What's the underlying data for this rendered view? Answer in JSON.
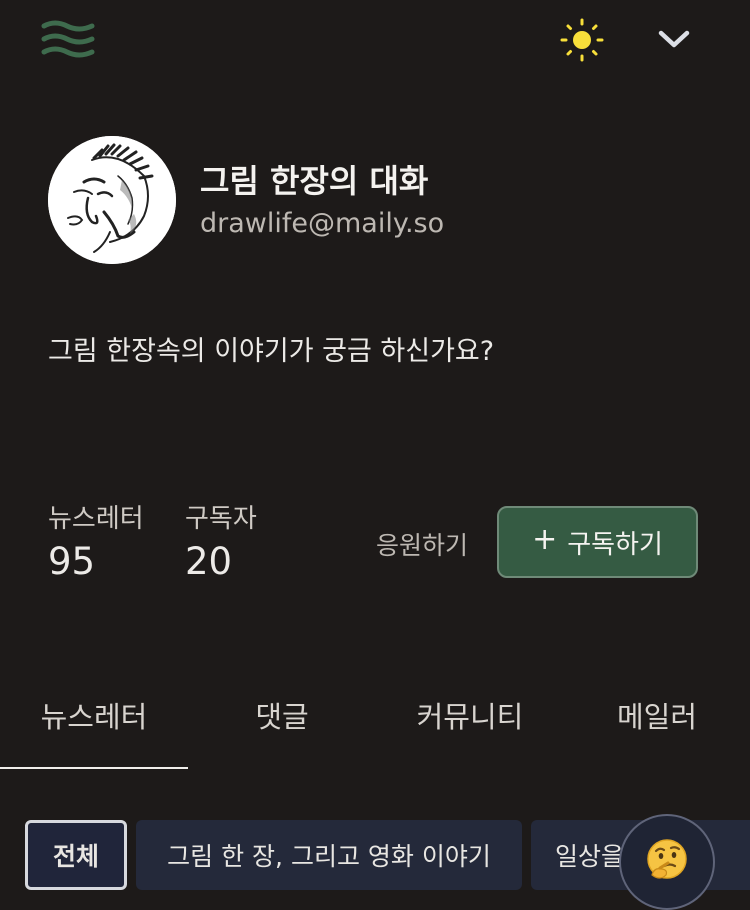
{
  "header": {
    "logo_icon": "wave-logo-icon",
    "theme_icon": "sun-icon",
    "menu_icon": "chevron-down-icon",
    "colors": {
      "logo": "#3e6b4d",
      "sun": "#f8df3a"
    }
  },
  "profile": {
    "avatar_icon": "sketch-face-avatar",
    "title": "그림 한장의 대화",
    "email": "drawlife@maily.so",
    "description": "그림 한장속의 이야기가 궁금 하신가요?"
  },
  "stats": {
    "newsletters_label": "뉴스레터",
    "newsletters_value": "95",
    "subscribers_label": "구독자",
    "subscribers_value": "20"
  },
  "actions": {
    "support_label": "응원하기",
    "subscribe_plus": "+",
    "subscribe_label": "구독하기",
    "accent_color": "#355b43"
  },
  "tabs": [
    "뉴스레터",
    "댓글",
    "커뮤니티",
    "메일러"
  ],
  "active_tab": "뉴스레터",
  "categories": [
    "전체",
    "그림 한 장, 그리고 영화 이야기",
    "일상을 그리"
  ],
  "active_category": "전체",
  "floating_button": {
    "emoji": "🤔",
    "icon": "thinking-face-icon"
  }
}
